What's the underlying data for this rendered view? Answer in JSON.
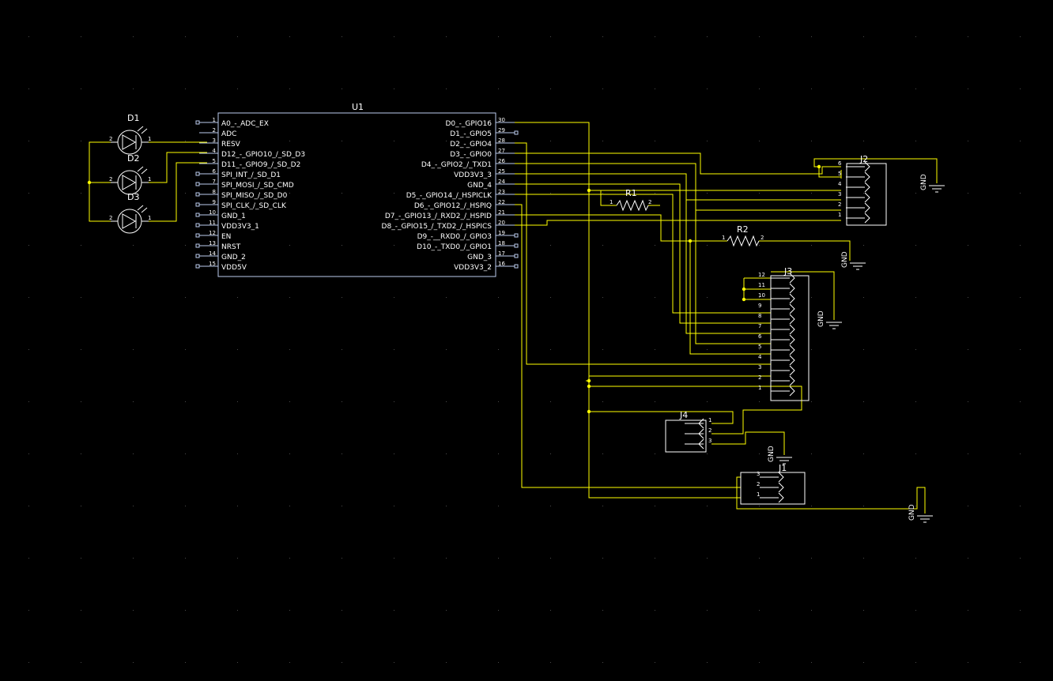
{
  "schematic": {
    "colors": {
      "background": "#000000",
      "wire": "#ffff00",
      "part": "#bbccee",
      "text": "#ffffff",
      "grid": "#4a4a4a"
    },
    "u1": {
      "ref": "U1",
      "left_pins": [
        {
          "num": "1",
          "name": "A0_-_ADC_EX"
        },
        {
          "num": "2",
          "name": "ADC"
        },
        {
          "num": "3",
          "name": "RESV"
        },
        {
          "num": "4",
          "name": "D12_-_GPIO10_/_SD_D3"
        },
        {
          "num": "5",
          "name": "D11_-_GPIO9_/_SD_D2"
        },
        {
          "num": "6",
          "name": "SPI_INT_/_SD_D1"
        },
        {
          "num": "7",
          "name": "SPI_MOSI_/_SD_CMD"
        },
        {
          "num": "8",
          "name": "SPI_MISO_/_SD_D0"
        },
        {
          "num": "9",
          "name": "SPI_CLK_/_SD_CLK"
        },
        {
          "num": "10",
          "name": "GND_1"
        },
        {
          "num": "11",
          "name": "VDD3V3_1"
        },
        {
          "num": "12",
          "name": "EN"
        },
        {
          "num": "13",
          "name": "NRST"
        },
        {
          "num": "14",
          "name": "GND_2"
        },
        {
          "num": "15",
          "name": "VDD5V"
        }
      ],
      "right_pins": [
        {
          "num": "30",
          "name": "D0_-_GPIO16"
        },
        {
          "num": "29",
          "name": "D1_-_GPIO5"
        },
        {
          "num": "28",
          "name": "D2_-_GPIO4"
        },
        {
          "num": "27",
          "name": "D3_-_GPIO0"
        },
        {
          "num": "26",
          "name": "D4_-_GPIO2_/_TXD1"
        },
        {
          "num": "25",
          "name": "VDD3V3_3"
        },
        {
          "num": "24",
          "name": "GND_4"
        },
        {
          "num": "23",
          "name": "D5_-_GPIO14_/_HSPICLK"
        },
        {
          "num": "22",
          "name": "D6_-_GPIO12_/_HSPIQ"
        },
        {
          "num": "21",
          "name": "D7_-_GPIO13_/_RXD2_/_HSPID"
        },
        {
          "num": "20",
          "name": "D8_-_GPIO15_/_TXD2_/_HSPICS"
        },
        {
          "num": "19",
          "name": "D9_-__RXD0_/_GPIO3"
        },
        {
          "num": "18",
          "name": "D10_-_TXD0_/_GPIO1"
        },
        {
          "num": "17",
          "name": "GND_3"
        },
        {
          "num": "16",
          "name": "VDD3V3_2"
        }
      ]
    },
    "leds": [
      {
        "ref": "D1",
        "pin_a": "2",
        "pin_k": "1"
      },
      {
        "ref": "D2",
        "pin_a": "2",
        "pin_k": "1"
      },
      {
        "ref": "D3",
        "pin_a": "2",
        "pin_k": "1"
      }
    ],
    "resistors": [
      {
        "ref": "R1",
        "pin1": "1",
        "pin2": "2"
      },
      {
        "ref": "R2",
        "pin1": "1",
        "pin2": "2"
      }
    ],
    "connectors": {
      "j2": {
        "ref": "J2",
        "pins": [
          "6",
          "5",
          "4",
          "3",
          "2",
          "1"
        ]
      },
      "j3": {
        "ref": "J3",
        "pins": [
          "12",
          "11",
          "10",
          "9",
          "8",
          "7",
          "6",
          "5",
          "4",
          "3",
          "2",
          "1"
        ]
      },
      "j4": {
        "ref": "J4",
        "pins": [
          "1",
          "2",
          "3"
        ]
      },
      "j1": {
        "ref": "J1",
        "pins": [
          "3",
          "2",
          "1"
        ]
      }
    },
    "gnd_label": "GND"
  }
}
